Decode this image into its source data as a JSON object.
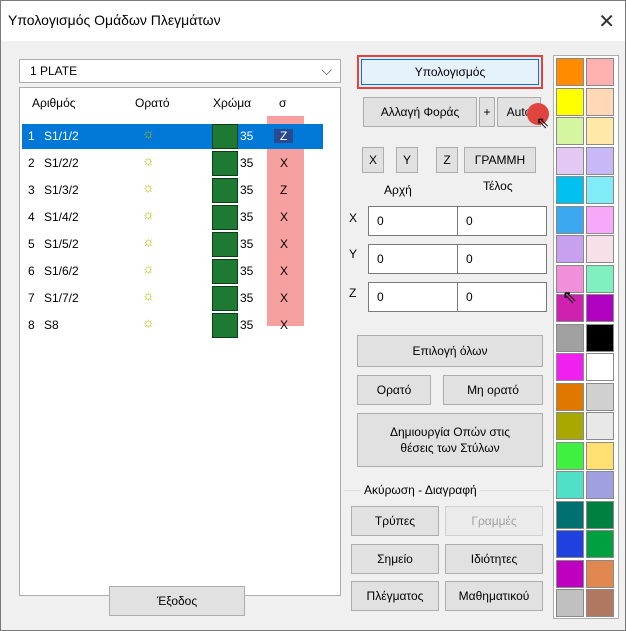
{
  "window": {
    "title": "Υπολογισμός Ομάδων Πλεγμάτων"
  },
  "combo": {
    "value": "1 PLATE"
  },
  "list": {
    "headers": [
      "Αριθμός",
      "Ορατό",
      "Χρώμα",
      "σ"
    ],
    "rows": [
      {
        "num": "1",
        "name": "S1/1/2",
        "width": "35",
        "axis": "Z"
      },
      {
        "num": "2",
        "name": "S1/2/2",
        "width": "35",
        "axis": "X"
      },
      {
        "num": "3",
        "name": "S1/3/2",
        "width": "35",
        "axis": "Z"
      },
      {
        "num": "4",
        "name": "S1/4/2",
        "width": "35",
        "axis": "X"
      },
      {
        "num": "5",
        "name": "S1/5/2",
        "width": "35",
        "axis": "X"
      },
      {
        "num": "6",
        "name": "S1/6/2",
        "width": "35",
        "axis": "X"
      },
      {
        "num": "7",
        "name": "S1/7/2",
        "width": "35",
        "axis": "X"
      },
      {
        "num": "8",
        "name": "S8",
        "width": "35",
        "axis": "X"
      }
    ],
    "visible_icon": "sun-icon",
    "row_color": "#1e7a33"
  },
  "buttons": {
    "calculate": "Υπολογισμός",
    "change_direction": "Αλλαγή Φοράς",
    "plus": "+",
    "auto": "Auto",
    "x": "X",
    "y": "Y",
    "z": "Z",
    "line": "ΓΡΑΜΜΗ",
    "select_all": "Επιλογή όλων",
    "visible": "Ορατό",
    "not_visible": "Μη ορατό",
    "create_holes_line1": "Δημιουργία Οπών στις",
    "create_holes_line2": "θέσεις των Στύλων",
    "holes": "Τρύπες",
    "lines": "Γραμμές",
    "point": "Σημείο",
    "properties": "Ιδιότητες",
    "meshes": "Πλέγματος",
    "math": "Μαθηματικού",
    "exit": "Έξοδος"
  },
  "coords": {
    "start_label": "Αρχή",
    "end_label": "Τέλος",
    "x_label": "X",
    "y_label": "Y",
    "z_label": "Z",
    "x_start": "0",
    "x_end": "0",
    "y_start": "0",
    "y_end": "0",
    "z_start": "0",
    "z_end": "0"
  },
  "group": {
    "label": "Ακύρωση - Διαγραφή"
  },
  "palette": [
    "#ff8c00",
    "#ffb0b0",
    "#ffff00",
    "#ffd8b8",
    "#d6f5a0",
    "#ffe8a8",
    "#e4c8f4",
    "#c8b8f8",
    "#00c0f0",
    "#80ecf8",
    "#3ca8f0",
    "#f8a8f8",
    "#c8a0f0",
    "#f8e0e8",
    "#f090d8",
    "#80f0c0",
    "#d020b0",
    "#b000c0",
    "#a0a0a0",
    "#000000",
    "#f020f0",
    "#ffffff",
    "#e07800",
    "#d0d0d0",
    "#a8a800",
    "#e8e8e8",
    "#40f040",
    "#ffe070",
    "#50e0c8",
    "#a0a0e0",
    "#007070",
    "#008040",
    "#2040e0",
    "#00a040",
    "#c000c0",
    "#e08850",
    "#c0c0c0",
    "#b07860"
  ]
}
